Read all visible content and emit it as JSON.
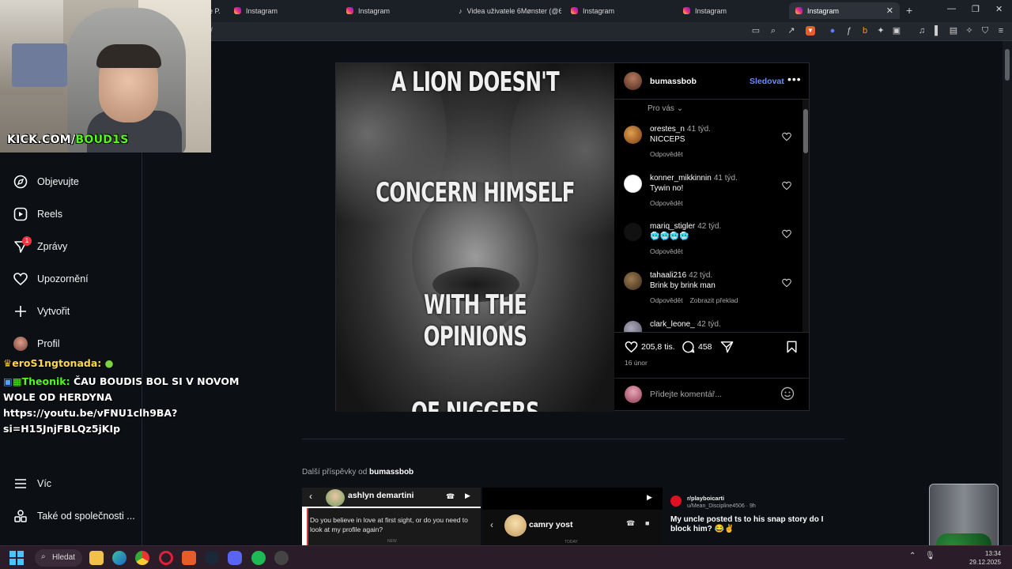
{
  "browser": {
    "tabs": [
      {
        "label": "Instagram"
      },
      {
        "label": "Instagram"
      },
      {
        "label": "Videa uživatele 6Mønster (@6"
      },
      {
        "label": "Instagram"
      },
      {
        "label": "Instagram"
      },
      {
        "label": "Instagram"
      }
    ],
    "partial_tab": "e P.",
    "url": "/"
  },
  "nav": {
    "items": [
      {
        "label": "Objevujte"
      },
      {
        "label": "Reels"
      },
      {
        "label": "Zprávy",
        "badge": "1"
      },
      {
        "label": "Upozornění"
      },
      {
        "label": "Vytvořit"
      },
      {
        "label": "Profil"
      }
    ],
    "more": "Víc",
    "meta": "Také od společnosti ..."
  },
  "post": {
    "image_text": [
      "A LION DOESN'T",
      "CONCERN HIMSELF",
      "WITH THE OPINIONS",
      "OF NIGGERS"
    ],
    "username": "bumassbob",
    "follow": "Sledovat",
    "sort": "Pro vás",
    "comments": [
      {
        "user": "orestes_n",
        "time": "41 týd.",
        "text": "NICCEPS",
        "reply": "Odpovědět",
        "translate": ""
      },
      {
        "user": "konner_mikkinnin",
        "time": "41 týd.",
        "text": "Tywin no!",
        "reply": "Odpovědět",
        "translate": ""
      },
      {
        "user": "mariq_stigler",
        "time": "42 týd.",
        "text": "🥶🥶🥶🥶",
        "reply": "Odpovědět",
        "translate": ""
      },
      {
        "user": "tahaali216",
        "time": "42 týd.",
        "text": "Brink by brink man",
        "reply": "Odpovědět",
        "translate": "Zobrazit překlad"
      },
      {
        "user": "clark_leone_",
        "time": "42 týd.",
        "text": "",
        "reply": "",
        "translate": ""
      }
    ],
    "likes": "205,8 tis.",
    "comment_count": "458",
    "date": "16 únor",
    "add_comment_placeholder": "Přidejte komentář..."
  },
  "more_posts": {
    "prefix": "Další příspěvky od",
    "user": "bumassbob",
    "thumb1": {
      "name": "ashlyn demartini",
      "text": "Do you believe in love at first sight, or do you need to look at my profile again?",
      "foot": "NEW"
    },
    "thumb2": {
      "name": "camry yost",
      "foot": "TODAY"
    },
    "thumb3": {
      "sub": "r/playboicarti",
      "user": "u/Mean_Discipline4506 · 9h",
      "text": "My uncle posted ts to his snap story do I block him? 😂✌️"
    }
  },
  "webcam": {
    "brand_prefix": "KICK.COM/",
    "brand_name": "BOUD1S"
  },
  "chat": {
    "line1_user": "eroS1ngtonada:",
    "line2_user": "Theonik:",
    "line2_msg": "ČAU BOUDIS BOL SI V NOVOM",
    "line3": "WOLE OD HERDYNA",
    "line4": "https://youtu.be/vFNU1clh9BA?",
    "line5": "si=H15JnjFBLQz5jKIp"
  },
  "taskbar": {
    "search": "Hledat",
    "time": "13:34",
    "date": "29.12.2025"
  },
  "colors": {
    "accent_blue": "#6d8cff",
    "kick_green": "#53fc18",
    "badge_red": "#ff3040"
  }
}
